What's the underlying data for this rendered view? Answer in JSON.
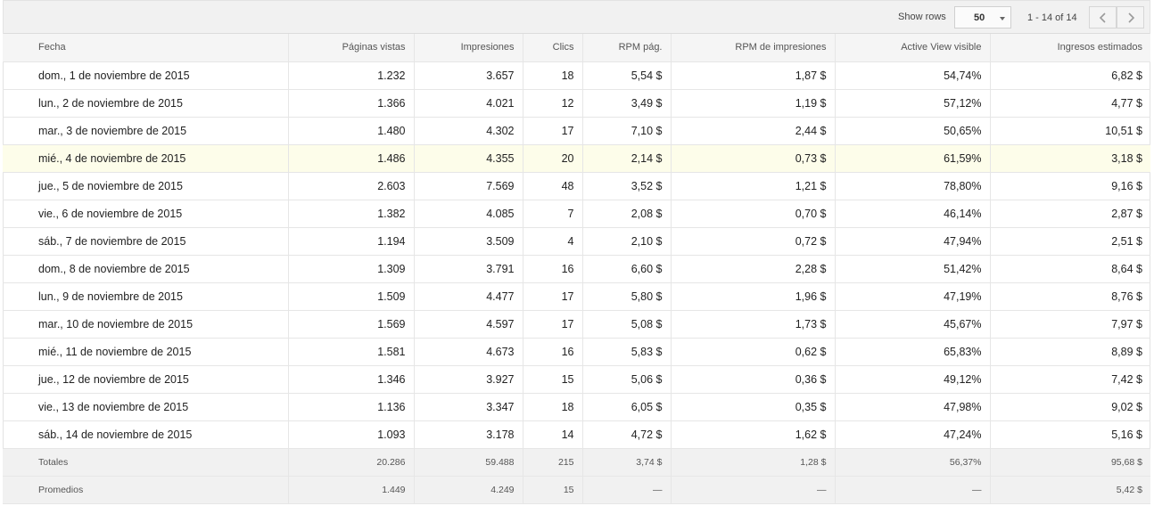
{
  "toolbar": {
    "show_rows_label": "Show rows",
    "rows_value": "50",
    "page_info": "1 - 14 of 14"
  },
  "table": {
    "columns": [
      "Fecha",
      "Páginas vistas",
      "Impresiones",
      "Clics",
      "RPM pág.",
      "RPM de impresiones",
      "Active View visible",
      "Ingresos estimados"
    ],
    "rows": [
      [
        "dom., 1 de noviembre de 2015",
        "1.232",
        "3.657",
        "18",
        "5,54 $",
        "1,87 $",
        "54,74%",
        "6,82 $"
      ],
      [
        "lun., 2 de noviembre de 2015",
        "1.366",
        "4.021",
        "12",
        "3,49 $",
        "1,19 $",
        "57,12%",
        "4,77 $"
      ],
      [
        "mar., 3 de noviembre de 2015",
        "1.480",
        "4.302",
        "17",
        "7,10 $",
        "2,44 $",
        "50,65%",
        "10,51 $"
      ],
      [
        "mié., 4 de noviembre de 2015",
        "1.486",
        "4.355",
        "20",
        "2,14 $",
        "0,73 $",
        "61,59%",
        "3,18 $"
      ],
      [
        "jue., 5 de noviembre de 2015",
        "2.603",
        "7.569",
        "48",
        "3,52 $",
        "1,21 $",
        "78,80%",
        "9,16 $"
      ],
      [
        "vie., 6 de noviembre de 2015",
        "1.382",
        "4.085",
        "7",
        "2,08 $",
        "0,70 $",
        "46,14%",
        "2,87 $"
      ],
      [
        "sáb., 7 de noviembre de 2015",
        "1.194",
        "3.509",
        "4",
        "2,10 $",
        "0,72 $",
        "47,94%",
        "2,51 $"
      ],
      [
        "dom., 8 de noviembre de 2015",
        "1.309",
        "3.791",
        "16",
        "6,60 $",
        "2,28 $",
        "51,42%",
        "8,64 $"
      ],
      [
        "lun., 9 de noviembre de 2015",
        "1.509",
        "4.477",
        "17",
        "5,80 $",
        "1,96 $",
        "47,19%",
        "8,76 $"
      ],
      [
        "mar., 10 de noviembre de 2015",
        "1.569",
        "4.597",
        "17",
        "5,08 $",
        "1,73 $",
        "45,67%",
        "7,97 $"
      ],
      [
        "mié., 11 de noviembre de 2015",
        "1.581",
        "4.673",
        "16",
        "5,83 $",
        "0,62 $",
        "65,83%",
        "8,89 $"
      ],
      [
        "jue., 12 de noviembre de 2015",
        "1.346",
        "3.927",
        "15",
        "5,06 $",
        "0,36 $",
        "49,12%",
        "7,42 $"
      ],
      [
        "vie., 13 de noviembre de 2015",
        "1.136",
        "3.347",
        "18",
        "6,05 $",
        "0,35 $",
        "47,98%",
        "9,02 $"
      ],
      [
        "sáb., 14 de noviembre de 2015",
        "1.093",
        "3.178",
        "14",
        "4,72 $",
        "1,62 $",
        "47,24%",
        "5,16 $"
      ]
    ],
    "footer": [
      [
        "Totales",
        "20.286",
        "59.488",
        "215",
        "3,74 $",
        "1,28 $",
        "56,37%",
        "95,68 $"
      ],
      [
        "Promedios",
        "1.449",
        "4.249",
        "15",
        "—",
        "—",
        "—",
        "5,42 $"
      ]
    ]
  }
}
